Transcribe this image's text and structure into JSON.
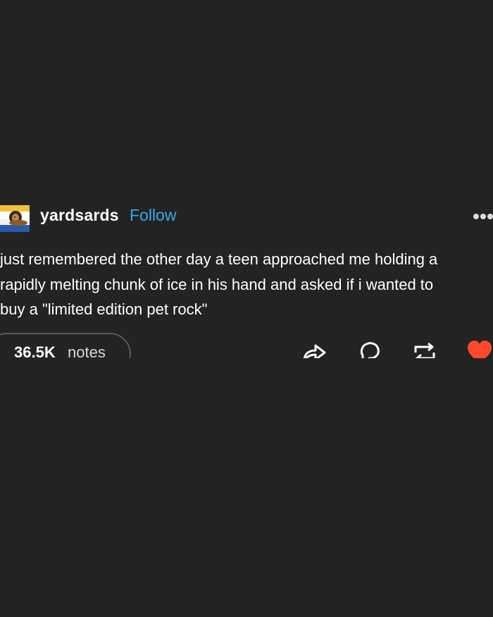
{
  "post": {
    "username": "yardsards",
    "follow_label": "Follow",
    "text_lines": [
      "just remembered the other day a teen approached me holding a",
      "rapidly melting chunk of ice in his hand and asked if i wanted to",
      "buy a \"limited edition pet rock\""
    ],
    "notes_count": "36.5K",
    "notes_label": "notes"
  },
  "icons": {
    "avatar": "lion-avatar",
    "more": "more-dots-icon",
    "share": "share-icon",
    "reply": "reply-icon",
    "reblog": "reblog-icon",
    "like": "heart-icon"
  },
  "colors": {
    "background": "#232323",
    "follow": "#3aa7e6",
    "heart": "#ff492f",
    "icon": "#ffffff"
  }
}
